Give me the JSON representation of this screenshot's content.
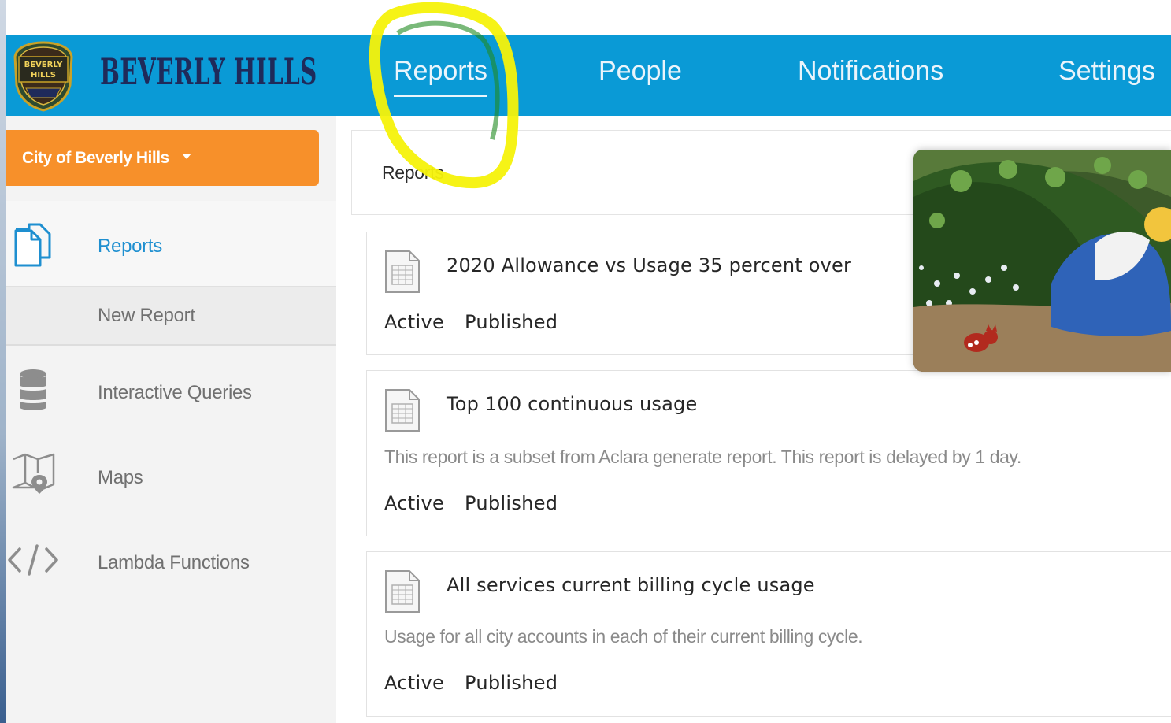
{
  "brand": {
    "logo_name": "BEVERLY HILLS",
    "seal_text": [
      "BEVERLY",
      "HILLS"
    ],
    "colors": {
      "nav_bg": "#0a9ad6",
      "brand_text": "#1f2a5a",
      "seal_gold": "#c9a227"
    }
  },
  "nav": {
    "items": [
      {
        "label": "Reports",
        "active": true
      },
      {
        "label": "People",
        "active": false
      },
      {
        "label": "Notifications",
        "active": false
      },
      {
        "label": "Settings",
        "active": false
      }
    ]
  },
  "sidebar": {
    "org_selector": {
      "label": "City of Beverly Hills",
      "color": "#f7902a"
    },
    "items": [
      {
        "label": "Reports",
        "icon": "documents-icon",
        "active": true
      },
      {
        "label": "New Report",
        "icon": null,
        "sub": true
      },
      {
        "label": "Interactive Queries",
        "icon": "database-icon"
      },
      {
        "label": "Maps",
        "icon": "map-pin-icon"
      },
      {
        "label": "Lambda Functions",
        "icon": "code-icon"
      }
    ]
  },
  "main": {
    "panel_title": "Reports",
    "reports": [
      {
        "title": "2020 Allowance vs Usage 35 percent over",
        "description": "",
        "status": "Active",
        "state": "Published"
      },
      {
        "title": "Top 100 continuous usage",
        "description": "This report is a subset from Aclara generate report. This report is delayed by 1 day.",
        "status": "Active",
        "state": "Published"
      },
      {
        "title": "All services current billing cycle usage",
        "description": "Usage for all city accounts in each of their current billing cycle.",
        "status": "Active",
        "state": "Published"
      }
    ]
  },
  "overlay": {
    "image": "cartoon-scene",
    "highlight_color": "#f5f20a"
  }
}
